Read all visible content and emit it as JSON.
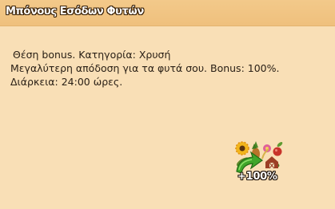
{
  "panel": {
    "title": "Μπόνους Εσόδων Φυτών",
    "description_line1": "Θέση bonus. Κατηγορία: Χρυσή",
    "description_line2": "Μεγαλύτερη απόδοση για τα φυτά σου. Bonus: 100%. Διάρκεια: 24:00 ώρες."
  },
  "badge": {
    "icon": "plants-bonus-icon",
    "label": "+100%"
  },
  "colors": {
    "panel_background": "#f9dfb6",
    "titlebar_background": "#efc07d",
    "title_text": "#ffffff",
    "body_text": "#2a2016"
  }
}
